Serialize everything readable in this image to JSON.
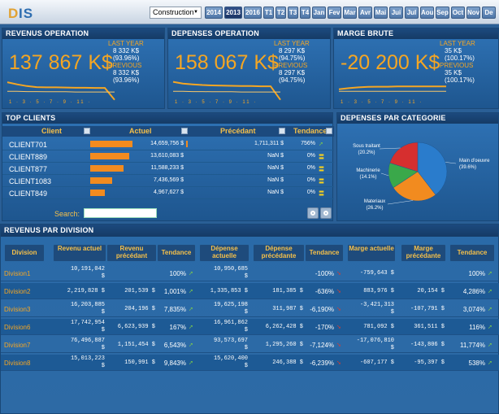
{
  "app": {
    "logo_d": "D",
    "logo_is": "IS"
  },
  "toolbar": {
    "sector": "Construction",
    "years": [
      "2014",
      "2013",
      "2016"
    ],
    "selected_year": "2013",
    "quarters": [
      "T1",
      "T2",
      "T3",
      "T4"
    ],
    "months": [
      "Jan",
      "Fev",
      "Mar",
      "Avr",
      "Mai",
      "Jui",
      "Jul",
      "Aou",
      "Sep",
      "Oct",
      "Nov",
      "De"
    ]
  },
  "kpis": [
    {
      "title": "REVENUS OPERATION",
      "value": "137 867 K$",
      "last_year_label": "LAST YEAR",
      "last_year_value": "8 332 K$",
      "last_year_pct": "(93.96%)",
      "previous_label": "PREVIOUS",
      "previous_value": "8 332 K$",
      "previous_pct": "(93.96%)",
      "axis": "1 · 3 · 5 · 7 · 9 · 11 ·",
      "spark_a": [
        0.12,
        0.22,
        0.3,
        0.35,
        0.36,
        0.36,
        0.37,
        0.38,
        0.38,
        0.39,
        0.39,
        0.95
      ],
      "spark_b": [
        0.55,
        0.55,
        0.56,
        0.56,
        0.57,
        0.57,
        0.57,
        0.58,
        0.58,
        0.58,
        0.58,
        0.58
      ]
    },
    {
      "title": "DEPENSES OPERATION",
      "value": "158 067 K$",
      "last_year_label": "LAST YEAR",
      "last_year_value": "8 297 K$",
      "last_year_pct": "(94.75%)",
      "previous_label": "PREVIOUS",
      "previous_value": "8 297 K$",
      "previous_pct": "(94.75%)",
      "axis": "1 · 3 · 5 · 7 · 9 · 11 ·",
      "spark_a": [
        0.1,
        0.18,
        0.22,
        0.25,
        0.27,
        0.28,
        0.29,
        0.3,
        0.3,
        0.31,
        0.31,
        0.95
      ],
      "spark_b": [
        0.55,
        0.55,
        0.56,
        0.56,
        0.57,
        0.57,
        0.57,
        0.58,
        0.58,
        0.58,
        0.58,
        0.58
      ]
    },
    {
      "title": "MARGE BRUTE",
      "value": "-20 200 K$",
      "last_year_label": "LAST YEAR",
      "last_year_value": "35 K$",
      "last_year_pct": "(100.17%)",
      "previous_label": "PREVIOUS",
      "previous_value": "35 K$",
      "previous_pct": "(100.17%)",
      "axis": "1 · 3 · 5 · 7 · 9 · 11 ·",
      "spark_a": [
        0.45,
        0.4,
        0.36,
        0.34,
        0.33,
        0.33,
        0.32,
        0.32,
        0.32,
        0.32,
        0.32,
        0.32
      ],
      "spark_b": [
        0.55,
        0.55,
        0.55,
        0.55,
        0.55,
        0.55,
        0.55,
        0.55,
        0.55,
        0.55,
        0.55,
        0.55
      ]
    }
  ],
  "top_clients": {
    "title": "TOP CLIENTS",
    "headers": {
      "client": "Client",
      "actuel": "Actuel",
      "precedant": "Précédant",
      "tendance": "Tendance"
    },
    "rows": [
      {
        "name": "CLIENT701",
        "actuel": "14,659,756 $",
        "share": 1.0,
        "precedant": "1,711,311 $",
        "pct": "756%",
        "trend": "up"
      },
      {
        "name": "CLIENT889",
        "actuel": "13,610,083 $",
        "share": 0.93,
        "precedant": "NaN $",
        "pct": "0%",
        "trend": "flat"
      },
      {
        "name": "CLIENT877",
        "actuel": "11,588,233 $",
        "share": 0.79,
        "precedant": "NaN $",
        "pct": "0%",
        "trend": "flat"
      },
      {
        "name": "CLIENT1083",
        "actuel": "7,436,569 $",
        "share": 0.51,
        "precedant": "NaN $",
        "pct": "0%",
        "trend": "flat"
      },
      {
        "name": "CLIENT849",
        "actuel": "4,967,627 $",
        "share": 0.34,
        "precedant": "NaN $",
        "pct": "0%",
        "trend": "flat"
      }
    ],
    "search_label": "Search:",
    "search_value": ""
  },
  "depenses": {
    "title": "DEPENSES PAR CATEGORIE",
    "slices": [
      {
        "label": "Main d'oeuvre",
        "pct_label": "(39.6%)",
        "value": 39.6,
        "color": "#2a7ccc"
      },
      {
        "label": "Materiaux",
        "pct_label": "(26.2%)",
        "value": 26.2,
        "color": "#f28b1f"
      },
      {
        "label": "Machinerie",
        "pct_label": "(14.1%)",
        "value": 14.1,
        "color": "#3aa84a"
      },
      {
        "label": "Sous traitant",
        "pct_label": "(20.2%)",
        "value": 20.2,
        "color": "#d62f2f"
      }
    ]
  },
  "division": {
    "title": "REVENUS PAR DIVISION",
    "headers": [
      "Division",
      "Revenu actuel",
      "Revenu précédant",
      "Tendance",
      "Dépense actuelle",
      "Dépense précédante",
      "Tendance",
      "Marge actuelle",
      "Marge précédante",
      "Tendance"
    ],
    "rows": [
      {
        "name": "Division1",
        "rev_a": "10,191,042 $",
        "rev_p": "",
        "t1": "100%",
        "t1d": "up",
        "dep_a": "10,950,685 $",
        "dep_p": "",
        "t2": "-100%",
        "t2d": "down",
        "mar_a": "-759,643 $",
        "mar_p": "",
        "t3": "100%",
        "t3d": "up"
      },
      {
        "name": "Division2",
        "rev_a": "2,219,828 $",
        "rev_p": "201,539 $",
        "t1": "1,001%",
        "t1d": "up",
        "dep_a": "1,335,853 $",
        "dep_p": "181,385 $",
        "t2": "-636%",
        "t2d": "down",
        "mar_a": "883,976 $",
        "mar_p": "20,154 $",
        "t3": "4,286%",
        "t3d": "up"
      },
      {
        "name": "Division3",
        "rev_a": "16,203,885 $",
        "rev_p": "204,196 $",
        "t1": "7,835%",
        "t1d": "up",
        "dep_a": "19,625,198 $",
        "dep_p": "311,987 $",
        "t2": "-6,190%",
        "t2d": "down",
        "mar_a": "-3,421,313 $",
        "mar_p": "-107,791 $",
        "t3": "3,074%",
        "t3d": "up"
      },
      {
        "name": "Division6",
        "rev_a": "17,742,954 $",
        "rev_p": "6,623,939 $",
        "t1": "167%",
        "t1d": "up",
        "dep_a": "16,961,862 $",
        "dep_p": "6,262,428 $",
        "t2": "-170%",
        "t2d": "down",
        "mar_a": "781,092 $",
        "mar_p": "361,511 $",
        "t3": "116%",
        "t3d": "up"
      },
      {
        "name": "Division7",
        "rev_a": "76,496,887 $",
        "rev_p": "1,151,454 $",
        "t1": "6,543%",
        "t1d": "up",
        "dep_a": "93,573,697 $",
        "dep_p": "1,295,260 $",
        "t2": "-7,124%",
        "t2d": "down",
        "mar_a": "-17,076,810 $",
        "mar_p": "-143,806 $",
        "t3": "11,774%",
        "t3d": "up"
      },
      {
        "name": "Division8",
        "rev_a": "15,013,223 $",
        "rev_p": "150,991 $",
        "t1": "9,843%",
        "t1d": "up",
        "dep_a": "15,620,400 $",
        "dep_p": "246,388 $",
        "t2": "-6,239%",
        "t2d": "down",
        "mar_a": "-607,177 $",
        "mar_p": "-95,397 $",
        "t3": "538%",
        "t3d": "up"
      }
    ]
  }
}
